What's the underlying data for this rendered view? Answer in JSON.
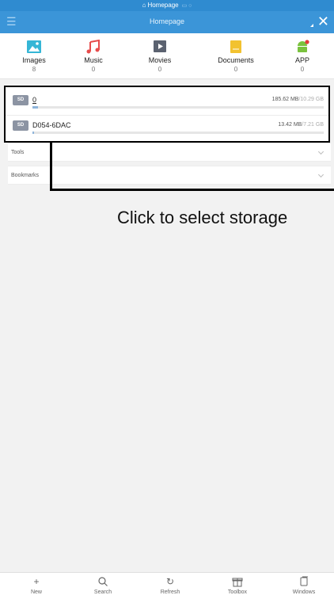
{
  "status_bar": {
    "title": "Homepage"
  },
  "app_bar": {
    "title": "Homepage"
  },
  "categories": [
    {
      "label": "Images",
      "count": "8",
      "icon": "image-icon"
    },
    {
      "label": "Music",
      "count": "0",
      "icon": "music-icon"
    },
    {
      "label": "Movies",
      "count": "0",
      "icon": "movie-icon"
    },
    {
      "label": "Documents",
      "count": "0",
      "icon": "document-icon"
    },
    {
      "label": "APP",
      "count": "0",
      "icon": "android-icon"
    }
  ],
  "storage": [
    {
      "badge": "SD",
      "name": "0",
      "used": "185.62 MB",
      "total": "/10.29 GB",
      "used_fraction": 0.018
    },
    {
      "badge": "SD",
      "name": "D054-6DAC",
      "used": "13.42 MB",
      "total": "/7.21 GB",
      "used_fraction": 0.002
    }
  ],
  "sections": {
    "tools": "Tools",
    "bookmarks": "Bookmarks"
  },
  "callout": "Click to select storage",
  "toolbar": [
    {
      "label": "New",
      "icon": "plus-icon"
    },
    {
      "label": "Search",
      "icon": "search-icon"
    },
    {
      "label": "Refresh",
      "icon": "refresh-icon"
    },
    {
      "label": "Toolbox",
      "icon": "gift-icon"
    },
    {
      "label": "Windows",
      "icon": "windows-icon"
    }
  ],
  "colors": {
    "accent": "#3b95d8",
    "status_bar": "#2f8bd0",
    "background": "#f2f2f2"
  }
}
